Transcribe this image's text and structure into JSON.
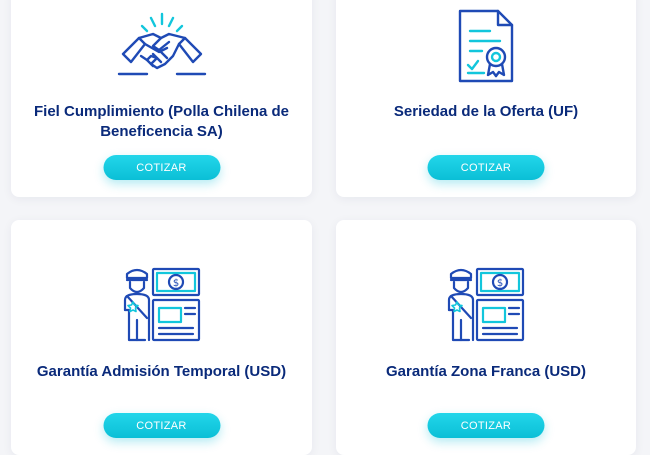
{
  "cards": [
    {
      "title": "Fiel Cumplimiento (Polla Chilena de Beneficencia SA)",
      "button_label": "COTIZAR",
      "icon": "handshake-icon"
    },
    {
      "title": "Seriedad de la Oferta (UF)",
      "button_label": "COTIZAR",
      "icon": "certificate-icon"
    },
    {
      "title": "Garantía Admisión Temporal (USD)",
      "button_label": "COTIZAR",
      "icon": "customs-officer-icon"
    },
    {
      "title": "Garantía Zona Franca (USD)",
      "button_label": "COTIZAR",
      "icon": "customs-officer-icon"
    }
  ],
  "colors": {
    "navy": "#0a2a7a",
    "icon_blue": "#1f4ab5",
    "accent_cyan": "#12c6dc",
    "background": "#f4f5f8"
  }
}
